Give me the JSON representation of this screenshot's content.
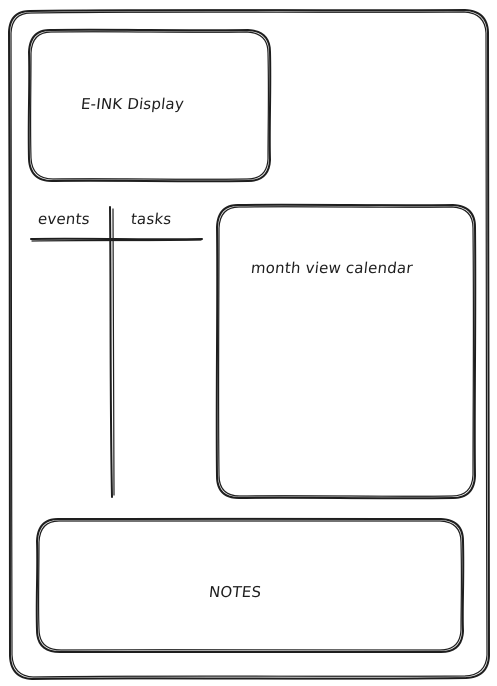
{
  "eink_display": {
    "label": "E-INK Display"
  },
  "list_panel": {
    "columns": [
      "events",
      "tasks"
    ]
  },
  "calendar": {
    "label": "month view calendar"
  },
  "notes": {
    "label": "NOTES"
  },
  "colors": {
    "stroke": "#1e1e1e",
    "background": "#ffffff"
  }
}
